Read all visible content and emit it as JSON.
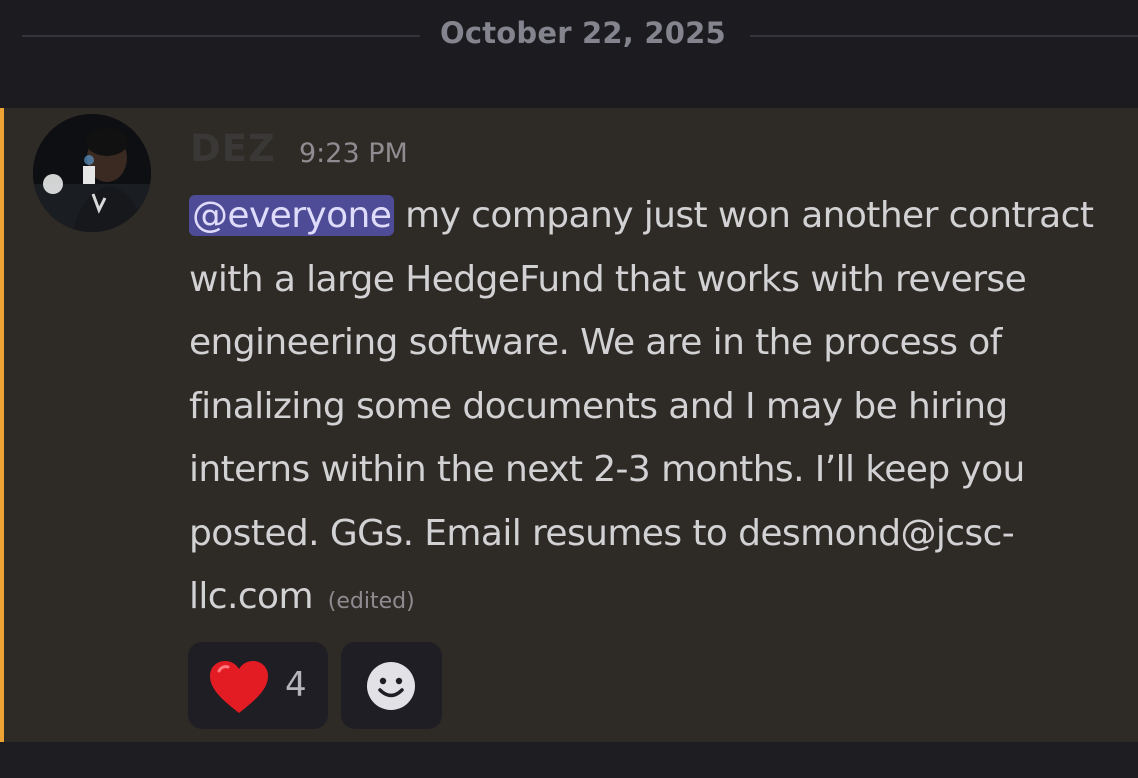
{
  "divider": {
    "date": "October 22, 2025"
  },
  "message": {
    "username": "DEZ",
    "timestamp": "9:23 PM",
    "mention": "@everyone",
    "text": " my company just won another contract with a large HedgeFund that works with reverse engineering software. We are in the process of finalizing some documents and I may be hiring interns within the next 2-3 months. I’ll keep you posted. GGs. Email resumes to desmond@jcsc-llc.com",
    "edited_label": "(edited)",
    "accent_color": "#eea233"
  },
  "reactions": [
    {
      "icon": "red-heart-icon",
      "count": "4"
    },
    {
      "icon": "add-reaction-smile-icon"
    }
  ]
}
